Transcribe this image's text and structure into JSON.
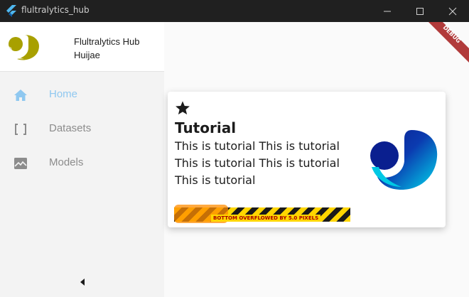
{
  "window": {
    "title": "flultralytics_hub",
    "controls": {
      "minimize": "minimize-icon",
      "maximize": "maximize-icon",
      "close": "close-icon"
    }
  },
  "sidebar": {
    "app_name": "Flultralytics Hub",
    "user_name": "Huijae",
    "items": [
      {
        "label": "Home",
        "icon": "home-icon",
        "active": true
      },
      {
        "label": "Datasets",
        "icon": "brackets-icon",
        "active": false
      },
      {
        "label": "Models",
        "icon": "image-icon",
        "active": false
      }
    ],
    "collapse_icon": "chevron-left-icon"
  },
  "debug_banner": {
    "label": "DEBUG"
  },
  "card": {
    "icon": "star-icon",
    "title": "Tutorial",
    "body": "This is tutorial This is tutorial This is tutorial This is tutorial This is tutorial",
    "logo": "ultralytics-logo-icon"
  },
  "overflow_warning": {
    "text": "BOTTOM OVERFLOWED BY 5.0 PIXELS"
  },
  "colors": {
    "titlebar": "#202020",
    "sidebar_bg": "#f3f3f3",
    "active_nav": "#8fc8f0",
    "inactive_nav": "#8c8c8c",
    "debug_banner": "#b13b3b",
    "logo_yellow": "#a8a000",
    "logo_blue_dark": "#0a2a9e",
    "logo_cyan": "#00d8ec"
  }
}
